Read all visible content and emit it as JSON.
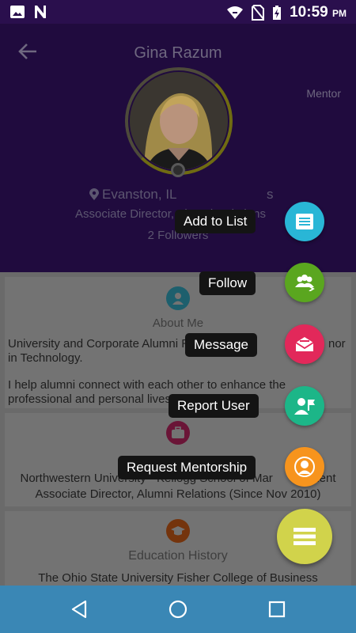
{
  "status_bar": {
    "time": "10:59",
    "ampm": "PM",
    "icons": [
      "image-icon",
      "notification-n-icon",
      "wifi-icon",
      "sim-off-icon",
      "battery-charging-icon"
    ]
  },
  "header": {
    "name": "Gina  Razum",
    "role": "Mentor",
    "location_head": "Evanston, IL",
    "location_tail": "s",
    "title": "Associate Director, Alumni Relations",
    "followers": "2 Followers"
  },
  "about": {
    "heading": "About Me",
    "line1": "University and Corporate Alumni R",
    "line1_tail": "ssi",
    "line1_end": "nor",
    "line2": "in Technology.",
    "line3": "I help alumni connect with each other to enhance their",
    "line4": "professional and personal lives"
  },
  "work": {
    "line1": "Northwestern University - Kellogg School of Mar",
    "line1_tail": "ement",
    "line2": "Associate Director, Alumni Relations (Since Nov 2010)"
  },
  "education": {
    "heading": "Education History",
    "line1": "The Ohio State University Fisher College of Business"
  },
  "fab_menu": [
    {
      "label": "Add to List",
      "color": "#29b6d6",
      "icon": "list-icon"
    },
    {
      "label": "Follow",
      "color": "#5aa61f",
      "icon": "follow-users-icon"
    },
    {
      "label": "Message",
      "color": "#e2285a",
      "icon": "envelope-icon"
    },
    {
      "label": "Report User",
      "color": "#1cb688",
      "icon": "report-flag-icon"
    },
    {
      "label": "Request Mentorship",
      "color": "#f7941d",
      "icon": "person-icon"
    }
  ],
  "fab_main": {
    "color": "#d1d34b",
    "icon": "menu-icon"
  },
  "nav_bar": {
    "color": "#3a87b5",
    "buttons": [
      "back-triangle-icon",
      "home-circle-icon",
      "recents-square-icon"
    ]
  }
}
